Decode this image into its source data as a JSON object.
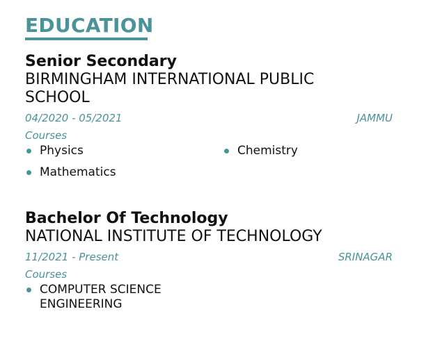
{
  "section": {
    "title": "EDUCATION",
    "accent_color": "#4a9399"
  },
  "entries": [
    {
      "degree": "Senior Secondary",
      "school": "BIRMINGHAM INTERNATIONAL PUBLIC SCHOOL",
      "dates": "04/2020 - 05/2021",
      "location": "JAMMU",
      "courses_label": "Courses",
      "courses": [
        "Physics",
        "Chemistry",
        "Mathematics"
      ]
    },
    {
      "degree": "Bachelor Of Technology",
      "school": "NATIONAL INSTITUTE OF TECHNOLOGY",
      "dates": "11/2021 - Present",
      "location": "SRINAGAR",
      "courses_label": "Courses",
      "courses": [
        "COMPUTER SCIENCE ENGINEERING"
      ]
    }
  ]
}
